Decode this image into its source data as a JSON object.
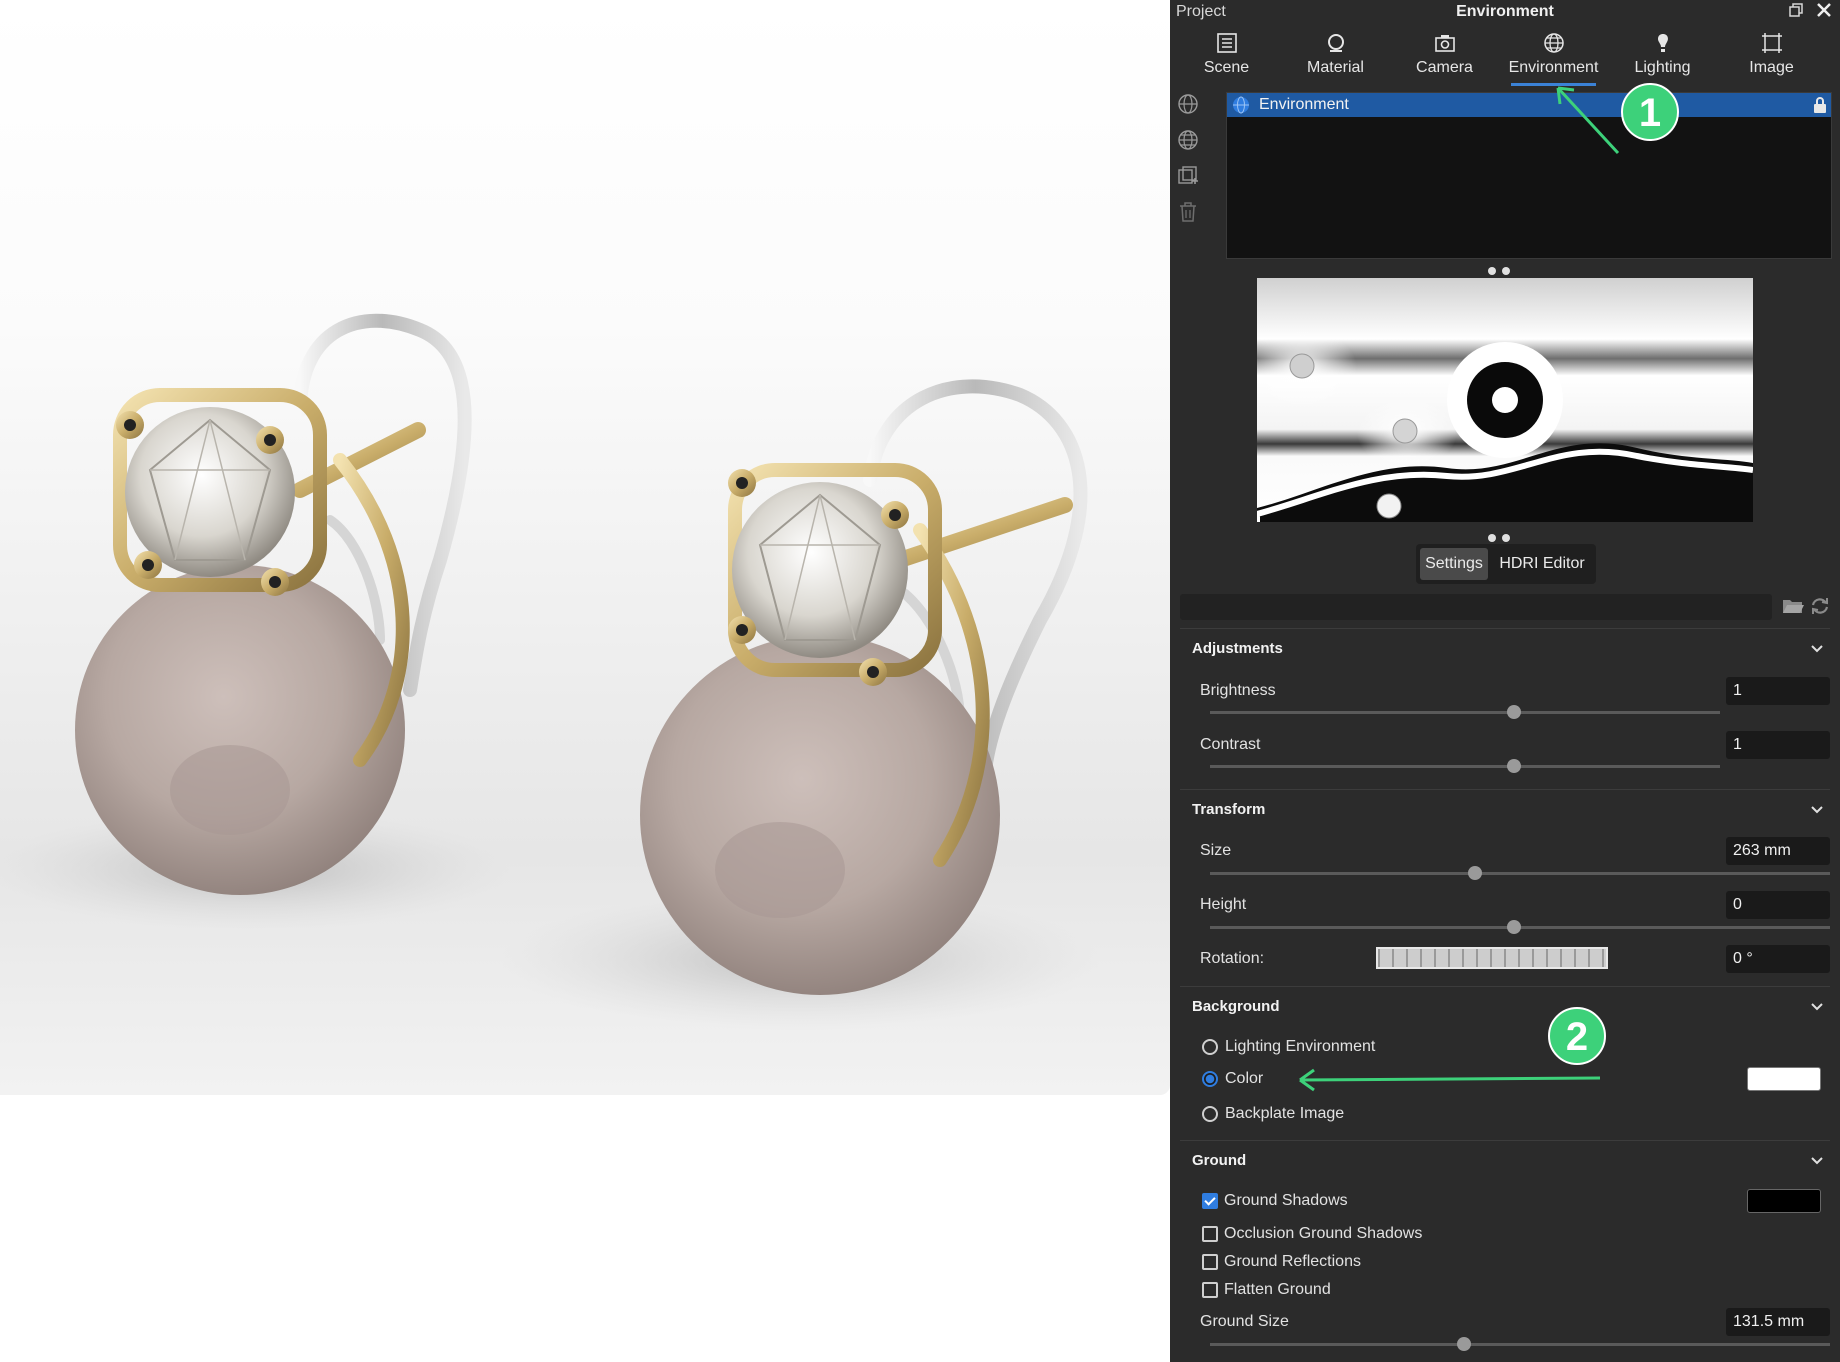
{
  "window": {
    "project_label": "Project",
    "title": "Environment"
  },
  "tabs": [
    {
      "label": "Scene",
      "icon": "scene-icon"
    },
    {
      "label": "Material",
      "icon": "material-icon"
    },
    {
      "label": "Camera",
      "icon": "camera-icon"
    },
    {
      "label": "Environment",
      "icon": "globe-icon",
      "active": true
    },
    {
      "label": "Lighting",
      "icon": "bulb-icon"
    },
    {
      "label": "Image",
      "icon": "image-icon"
    }
  ],
  "environment_list": {
    "items": [
      {
        "name": "Environment",
        "selected": true,
        "locked": true
      }
    ]
  },
  "view_tabs": {
    "settings": "Settings",
    "hdri_editor": "HDRI Editor",
    "selected": "Settings"
  },
  "adjustments": {
    "title": "Adjustments",
    "brightness": {
      "label": "Brightness",
      "value": "1"
    },
    "contrast": {
      "label": "Contrast",
      "value": "1"
    }
  },
  "transform": {
    "title": "Transform",
    "size": {
      "label": "Size",
      "value": "263 mm"
    },
    "height": {
      "label": "Height",
      "value": "0"
    },
    "rotation": {
      "label": "Rotation:",
      "value": "0 °"
    }
  },
  "background": {
    "title": "Background",
    "options": [
      "Lighting Environment",
      "Color",
      "Backplate Image"
    ],
    "selected": "Color",
    "color": "#ffffff"
  },
  "ground": {
    "title": "Ground",
    "ground_shadows": {
      "label": "Ground Shadows",
      "checked": true,
      "color": "#000000"
    },
    "occlusion_ground_shadows": {
      "label": "Occlusion Ground Shadows",
      "checked": false
    },
    "ground_reflections": {
      "label": "Ground Reflections",
      "checked": false
    },
    "flatten_ground": {
      "label": "Flatten Ground",
      "checked": false
    },
    "ground_size": {
      "label": "Ground Size",
      "value": "131.5 mm"
    }
  },
  "annotations": {
    "marker_1": "1",
    "marker_2": "2",
    "color": "#3dd17a"
  },
  "colors": {
    "panel_bg": "#2b2b2b",
    "accent": "#2f7de0",
    "selection": "#1f5aa3"
  }
}
